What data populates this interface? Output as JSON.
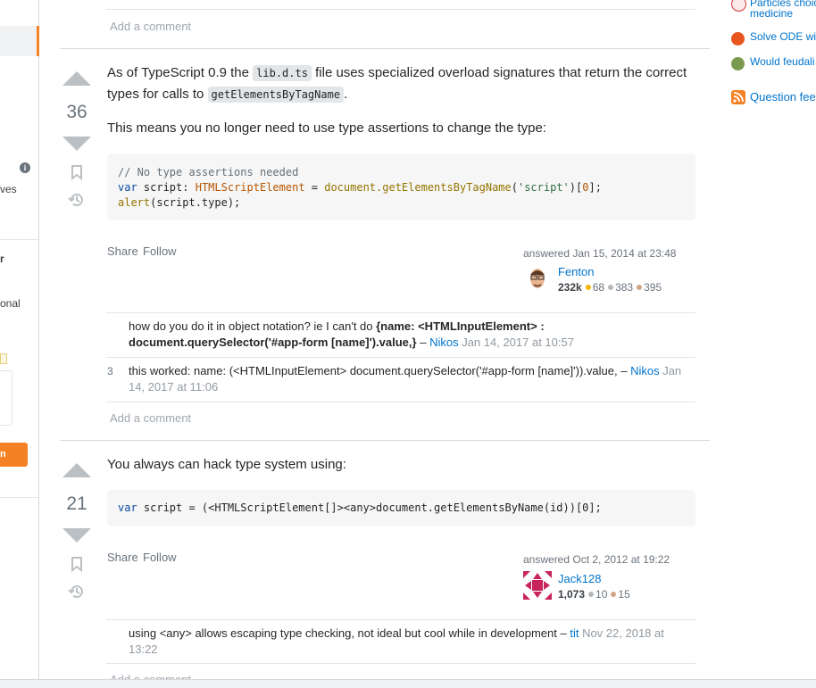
{
  "left_sidebar": {
    "fragment_ves": "ves",
    "fragment_r": "r",
    "fragment_onal": "onal",
    "fragment_button": "n"
  },
  "right_sidebar": {
    "items": [
      {
        "label_line1": "Particles choic",
        "label_line2": "medicine",
        "icon": "chemistry-icon",
        "color": "#d1383d"
      },
      {
        "label_line1": "Solve ODE wit",
        "icon": "math-icon",
        "color": "#e8561e"
      },
      {
        "label_line1": "Would feudali",
        "icon": "worldbuilding-icon",
        "color": "#7c9a4e"
      }
    ],
    "feed_label": "Question fee"
  },
  "top_comment": {
    "add_comment": "Add a comment"
  },
  "answers": [
    {
      "score": "36",
      "paragraph1_a": "As of TypeScript 0.9 the ",
      "paragraph1_code1": "lib.d.ts",
      "paragraph1_b": " file uses specialized overload signatures that return the correct types for calls to ",
      "paragraph1_code2": "getElementsByTagName",
      "paragraph1_c": ".",
      "paragraph2": "This means you no longer need to use type assertions to change the type:",
      "code_comment": "// No type assertions needed",
      "code_kw": "var",
      "code_var": " script: ",
      "code_type": "HTMLScriptElement",
      "code_eq": " = ",
      "code_call": "document.getElementsByTagName",
      "code_paren_open": "(",
      "code_str": "'script'",
      "code_paren_close": ")[",
      "code_num": "0",
      "code_end": "];",
      "code_alert": "alert",
      "code_alert_args": "(script.type);",
      "share": "Share",
      "follow": "Follow",
      "answered": "answered Jan 15, 2014 at 23:48",
      "user": "Fenton",
      "rep": "232k",
      "gold": "68",
      "silver": "383",
      "bronze": "395",
      "comments": [
        {
          "count": "",
          "text_a": "how do you do it in object notation? ie I can't do ",
          "text_bold": "{name: <HTMLInputElement> : document.querySelector('#app-form [name]').value,}",
          "sep": " – ",
          "user": "Nikos",
          "date": " Jan 14, 2017 at 10:57"
        },
        {
          "count": "3",
          "text_a": "this worked: name: (<HTMLInputElement> document.querySelector('#app-form [name]')).value,",
          "text_bold": "",
          "sep": " – ",
          "user": "Nikos",
          "date": " Jan 14, 2017 at 11:06"
        }
      ],
      "add_comment": "Add a comment"
    },
    {
      "score": "21",
      "paragraph1": "You always can hack type system using:",
      "code_kw": "var",
      "code_rest": " script = (<HTMLScriptElement[]><any>document.getElementsByName(id))[0];",
      "share": "Share",
      "follow": "Follow",
      "answered": "answered Oct 2, 2012 at 19:22",
      "user": "Jack128",
      "rep": "1,073",
      "silver": "10",
      "bronze": "15",
      "comments": [
        {
          "count": "",
          "text_a": "using <any> allows escaping type checking, not ideal but cool while in development",
          "sep": " – ",
          "user": "tit",
          "date": " Nov 22, 2018 at 13:22"
        }
      ],
      "add_comment": "Add a comment"
    }
  ],
  "colors": {
    "accent": "#f48225",
    "link": "#0074cc",
    "gold": "#f1b600",
    "silver": "#b4b8bc",
    "bronze": "#d1a684"
  }
}
